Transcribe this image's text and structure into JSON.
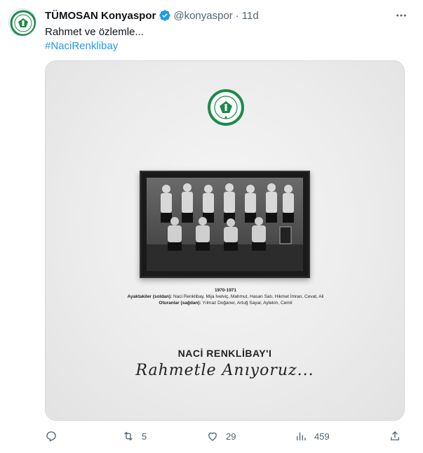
{
  "tweet": {
    "display_name": "TÜMOSAN Konyaspor",
    "handle": "@konyaspor",
    "separator": "·",
    "time": "11d",
    "text": "Rahmet ve özlemle...",
    "hashtag": "#NaciRenklibay"
  },
  "media": {
    "logo_text": "KONYASPOR",
    "caption_year": "1970-1971",
    "caption_standing_label": "Ayaktakiler (soldan):",
    "caption_standing": "Naci Renklibay, Mija İvelviç, Mahmut, Hasan Satı, Hikmet İmran, Cevat, Ali",
    "caption_sitting_label": "Oturanlar (sağdan):",
    "caption_sitting": "Yılmaz Doğaner, Artuğ Sayar, Aytekin, Cemil",
    "name_title": "NACİ RENKLİBAY'I",
    "script_line": "Rahmetle Anıyoruz..."
  },
  "actions": {
    "reply_count": "",
    "retweet_count": "5",
    "like_count": "29",
    "views_count": "459"
  },
  "colors": {
    "accent": "#1d9bf0",
    "muted": "#536471",
    "club_green": "#1e8a4a"
  }
}
